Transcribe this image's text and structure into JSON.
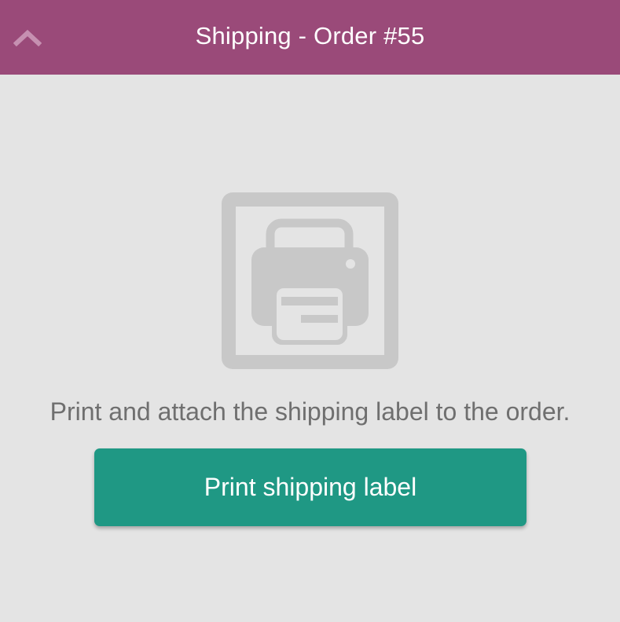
{
  "header": {
    "title": "Shipping - Order #55",
    "back_icon": "chevron-up-icon"
  },
  "main": {
    "illustration_icon": "printer-icon",
    "instruction": "Print and attach the shipping label to the order.",
    "print_button_label": "Print shipping label"
  },
  "colors": {
    "header_bg": "#9a4a79",
    "page_bg": "#e4e4e4",
    "button_bg": "#1f9884",
    "illustration": "#c8c8c8",
    "text_muted": "#6f6f6f"
  }
}
